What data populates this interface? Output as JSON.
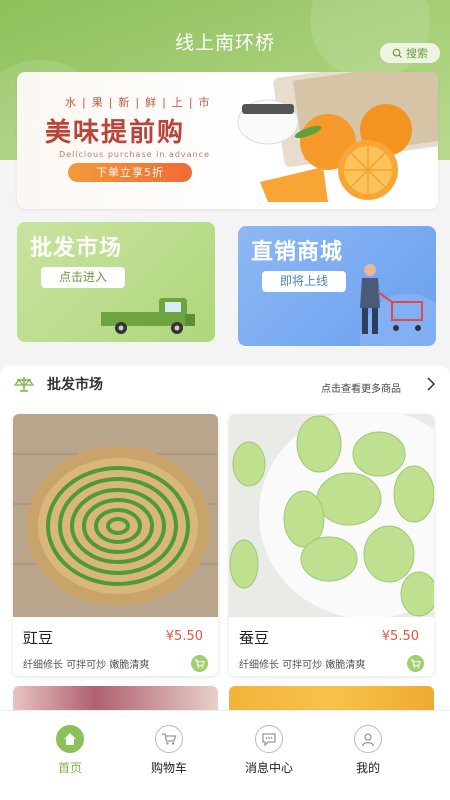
{
  "header": {
    "title": "线上南环桥",
    "search_label": "搜索"
  },
  "banner": {
    "subtitle": "水|果|新|鲜|上|市",
    "title": "美味提前购",
    "title_en": "Delicious purchase in advance",
    "cta": "下单立享5折"
  },
  "entries": [
    {
      "title": "批发市场",
      "button": "点击进入"
    },
    {
      "title": "直销商城",
      "button": "即将上线"
    }
  ],
  "section": {
    "title": "批发市场",
    "more": "点击查看更多商品"
  },
  "products": [
    {
      "name": "豇豆",
      "price": "¥5.50",
      "desc": "纤细修长 可拌可炒 嫩脆清爽"
    },
    {
      "name": "蚕豆",
      "price": "¥5.50",
      "desc": "纤细修长 可拌可炒 嫩脆清爽"
    }
  ],
  "tabbar": [
    {
      "label": "首页",
      "icon": "home-icon",
      "active": true
    },
    {
      "label": "购物车",
      "icon": "cart-icon",
      "active": false
    },
    {
      "label": "消息中心",
      "icon": "message-icon",
      "active": false
    },
    {
      "label": "我的",
      "icon": "profile-icon",
      "active": false
    }
  ],
  "colors": {
    "primary": "#8cc05a",
    "accent": "#e05a3c",
    "direct_blue": "#6a9ff0"
  }
}
